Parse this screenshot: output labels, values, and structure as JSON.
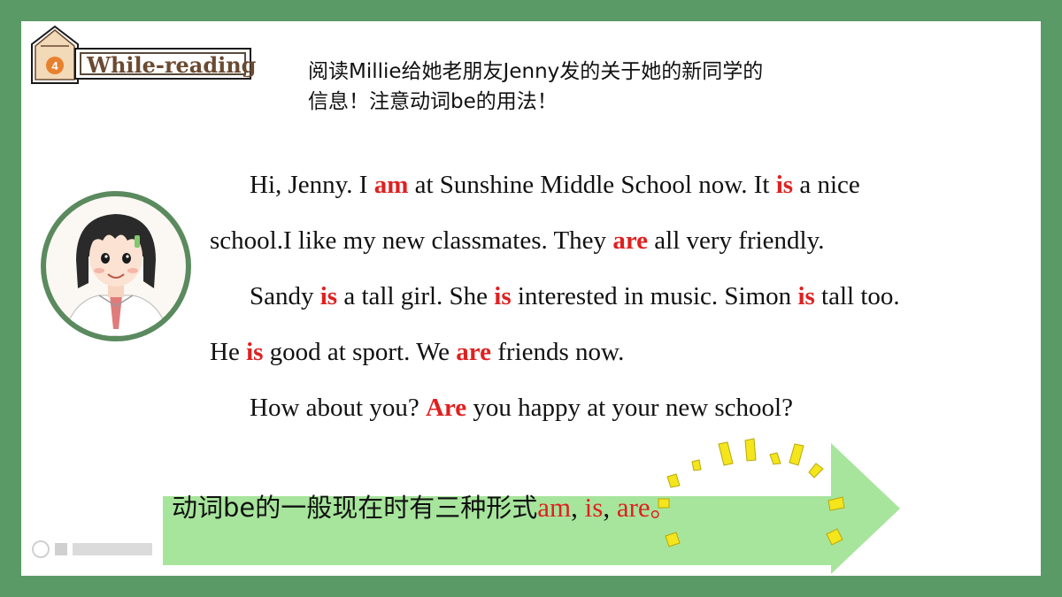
{
  "header": {
    "step_number": "4",
    "section_label": "While-reading"
  },
  "instruction": {
    "line1": "阅读Millie给她老朋友Jenny发的关于她的新同学的",
    "line2": "信息！注意动词be的用法！"
  },
  "passage": {
    "p1_l1": {
      "a": "Hi, Jenny. I ",
      "b": "am",
      "c": " at Sunshine Middle School now. It ",
      "d": "is",
      "e": " a nice"
    },
    "p1_l2": {
      "a": "school.I like my new classmates. They ",
      "b": "are",
      "c": " all very friendly."
    },
    "p2_l1": {
      "a": "Sandy ",
      "b": "is",
      "c": " a tall girl. She ",
      "d": "is",
      "e": " interested in music. Simon ",
      "f": "is",
      "g": " tall too."
    },
    "p2_l2": {
      "a": "He ",
      "b": "is",
      "c": " good at sport. We ",
      "d": "are",
      "e": " friends now."
    },
    "p3_l1": {
      "a": "How about you? ",
      "b": "Are",
      "c": " you happy at your new school?"
    }
  },
  "summary": {
    "prefix": "动词be的一般现在时有三种形式",
    "form1": "am",
    "sep1": ", ",
    "form2": "is",
    "sep2": ", ",
    "form3": "are",
    "suffix": "。"
  },
  "colors": {
    "frame_green": "#5a9a67",
    "highlight_red": "#e02020",
    "arrow_green": "#a7e59c",
    "spark_yellow": "#f4e51c"
  },
  "icons": [
    "pencil-badge-icon",
    "girl-portrait",
    "sparkle-burst-icon",
    "watermark-logo"
  ]
}
